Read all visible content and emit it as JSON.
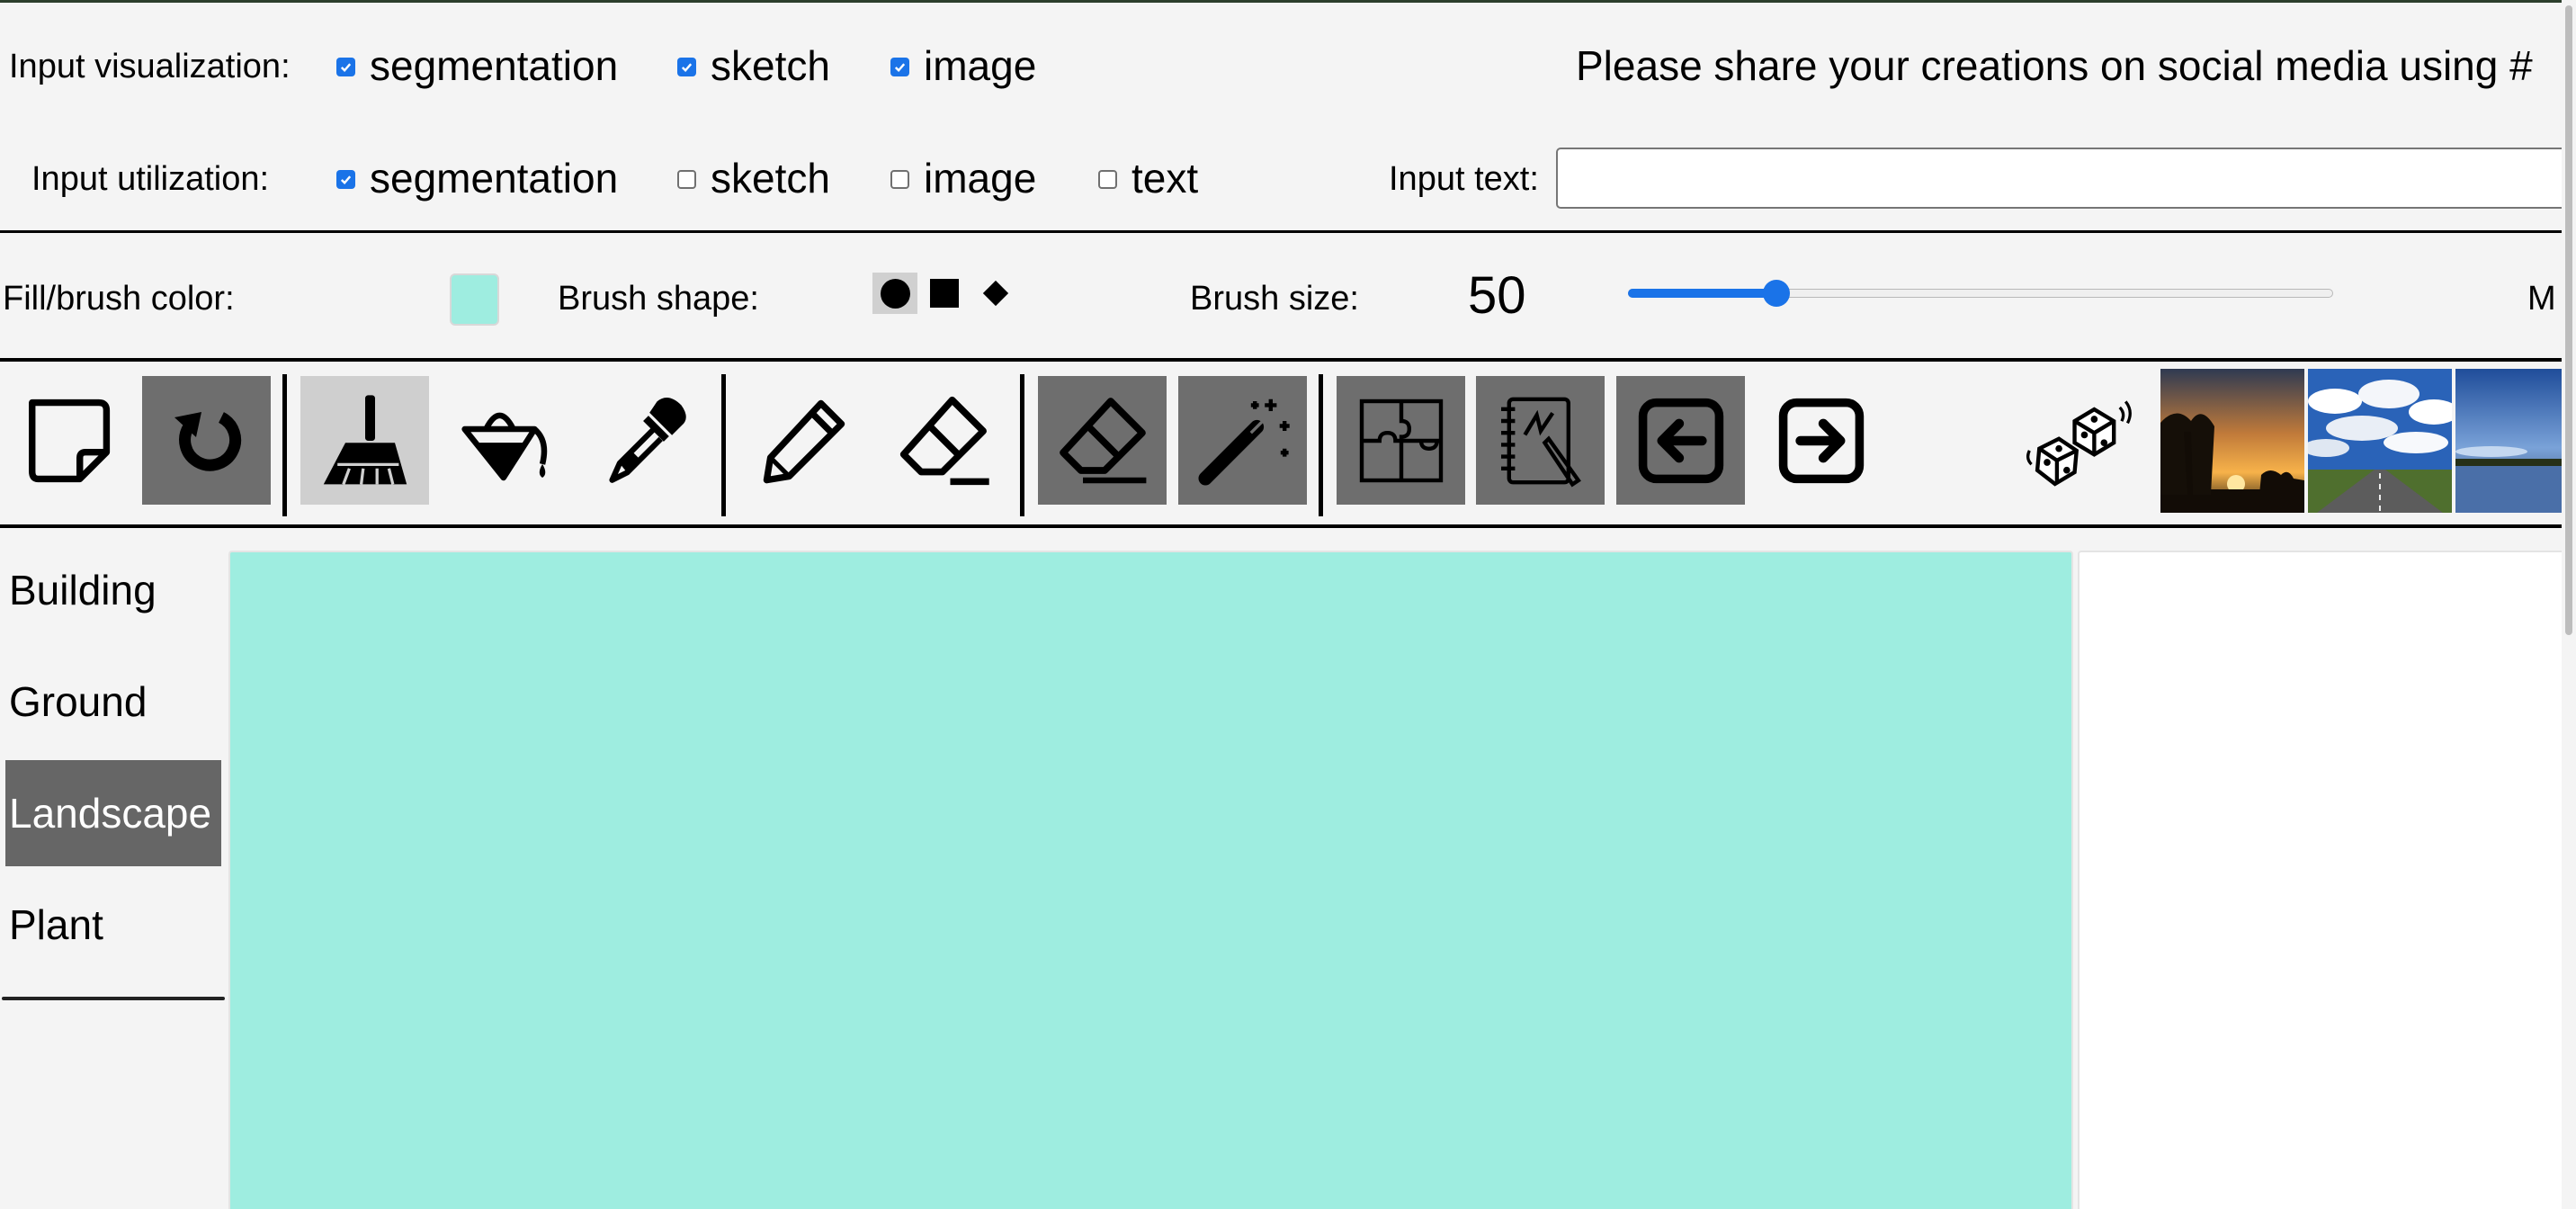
{
  "input_visualization": {
    "label": "Input visualization:",
    "options": [
      {
        "label": "segmentation",
        "checked": true
      },
      {
        "label": "sketch",
        "checked": true
      },
      {
        "label": "image",
        "checked": true
      }
    ]
  },
  "share_text": "Please share your creations on social media using #",
  "input_utilization": {
    "label": "Input utilization:",
    "options": [
      {
        "label": "segmentation",
        "checked": true
      },
      {
        "label": "sketch",
        "checked": false
      },
      {
        "label": "image",
        "checked": false
      },
      {
        "label": "text",
        "checked": false
      }
    ]
  },
  "input_text": {
    "label": "Input text:",
    "value": ""
  },
  "fill_color": {
    "label": "Fill/brush color:",
    "color": "#9eede0"
  },
  "brush_shape": {
    "label": "Brush shape:",
    "shapes": [
      "circle-icon",
      "square-icon",
      "diamond-icon"
    ],
    "selected": "circle"
  },
  "brush_size": {
    "label": "Brush size:",
    "value": "50",
    "slider_fraction": 0.21
  },
  "truncated_right_label": "M",
  "toolbar": {
    "tools": [
      "new-canvas-icon",
      "undo-icon",
      "broom-icon",
      "paint-bucket-icon",
      "eyedropper-icon",
      "pencil-icon",
      "line-eraser-icon",
      "eraser-icon",
      "magic-wand-icon",
      "puzzle-icon",
      "sketchbook-icon",
      "back-arrow-icon",
      "forward-arrow-icon",
      "dice-icon"
    ],
    "thumbnails": [
      "sunset-thumbnail",
      "road-sky-thumbnail",
      "lake-thumbnail"
    ]
  },
  "categories": [
    {
      "label": "Building",
      "active": false
    },
    {
      "label": "Ground",
      "active": false
    },
    {
      "label": "Landscape",
      "active": true
    },
    {
      "label": "Plant",
      "active": false
    }
  ],
  "canvas": {
    "fill_color": "#9eede0"
  },
  "colors": {
    "accent": "#1a73e8",
    "tool_dark": "#6e6e6e",
    "tool_selected": "#cfcfcf"
  }
}
